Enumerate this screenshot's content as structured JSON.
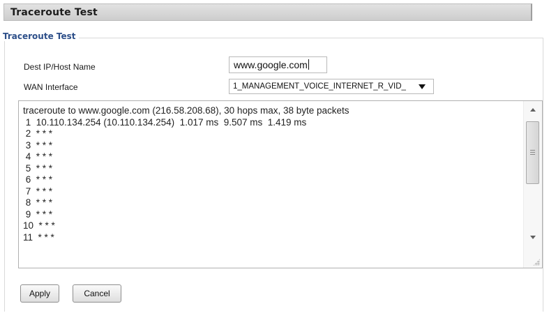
{
  "header": {
    "title": "Traceroute Test"
  },
  "section": {
    "legend": "Traceroute Test"
  },
  "form": {
    "dest_label": "Dest IP/Host Name",
    "dest_value": "www.google.com",
    "wan_label": "WAN Interface",
    "wan_selected": "1_MANAGEMENT_VOICE_INTERNET_R_VID_"
  },
  "output": {
    "text": "traceroute to www.google.com (216.58.208.68), 30 hops max, 38 byte packets\n 1  10.110.134.254 (10.110.134.254)  1.017 ms  9.507 ms  1.419 ms\n 2  * * *\n 3  * * *\n 4  * * *\n 5  * * *\n 6  * * *\n 7  * * *\n 8  * * *\n 9  * * *\n10  * * *\n11  * * *"
  },
  "buttons": {
    "apply": "Apply",
    "cancel": "Cancel"
  },
  "icons": {
    "dropdown": "chevron-down-icon",
    "scroll_up": "arrow-up-icon",
    "scroll_down": "arrow-down-icon",
    "resize": "resize-grip-icon"
  },
  "colors": {
    "legend": "#2d4f89",
    "header_bar": "#d6d6d6"
  }
}
